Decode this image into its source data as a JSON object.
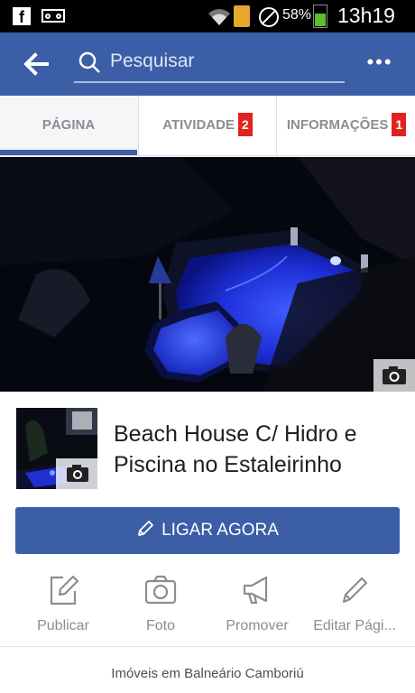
{
  "status_bar": {
    "facebook_logo": "f",
    "battery_percent": "58%",
    "battery_level": 0.58,
    "time": "13h19",
    "icons": [
      "facebook-icon",
      "voicemail-icon",
      "wifi-icon",
      "document-icon",
      "no-interruption-icon",
      "battery-icon"
    ]
  },
  "header": {
    "search_placeholder": "Pesquisar",
    "more_label": "•••",
    "colors": {
      "bar": "#3b5ea7"
    }
  },
  "tabs": [
    {
      "label": "PÁGINA",
      "badge": ""
    },
    {
      "label": "ATIVIDADE",
      "badge": "2"
    },
    {
      "label": "INFORMAÇÕES",
      "badge": "1"
    }
  ],
  "page": {
    "title": "Beach House C/ Hidro e Piscina no Estaleirinho",
    "call_button": "LIGAR AGORA",
    "category": "Imóveis em Balneário Camboriú"
  },
  "actions": [
    {
      "label": "Publicar",
      "icon": "compose-icon"
    },
    {
      "label": "Foto",
      "icon": "camera-icon"
    },
    {
      "label": "Promover",
      "icon": "megaphone-icon"
    },
    {
      "label": "Editar Pági...",
      "icon": "pencil-icon"
    }
  ],
  "colors": {
    "accent": "#3b5ea7",
    "badge": "#e0231f"
  }
}
